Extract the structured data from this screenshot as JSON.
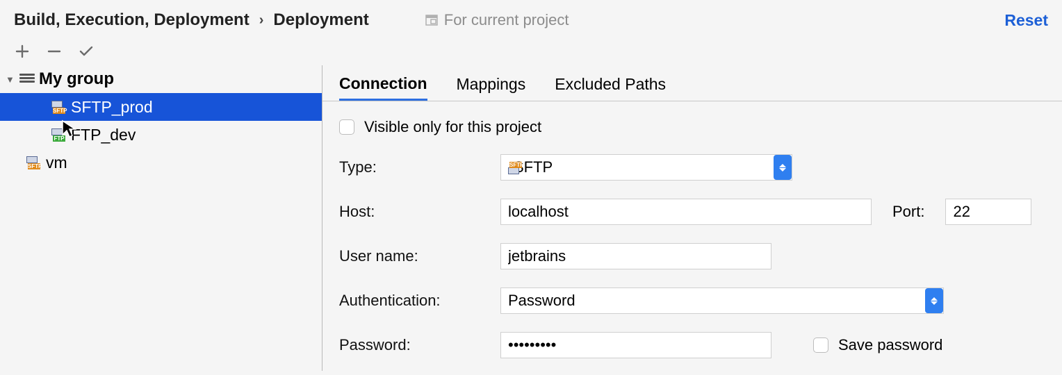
{
  "header": {
    "breadcrumb": [
      "Build, Execution, Deployment",
      "Deployment"
    ],
    "scope_label": "For current project",
    "reset": "Reset"
  },
  "tree": {
    "group": "My group",
    "items": [
      {
        "name": "SFTP_prod",
        "protocol": "SFTP",
        "selected": true
      },
      {
        "name": "FTP_dev",
        "protocol": "FTP",
        "selected": false
      }
    ],
    "root_items": [
      {
        "name": "vm",
        "protocol": "SFTP"
      }
    ]
  },
  "tabs": {
    "active": 0,
    "items": [
      "Connection",
      "Mappings",
      "Excluded Paths"
    ]
  },
  "form": {
    "visible_only_label": "Visible only for this project",
    "type_label": "Type:",
    "type_value": "SFTP",
    "host_label": "Host:",
    "host_value": "localhost",
    "port_label": "Port:",
    "port_value": "22",
    "user_label": "User name:",
    "user_value": "jetbrains",
    "auth_label": "Authentication:",
    "auth_value": "Password",
    "password_label": "Password:",
    "password_value": "•••••••••",
    "save_password_label": "Save password"
  }
}
